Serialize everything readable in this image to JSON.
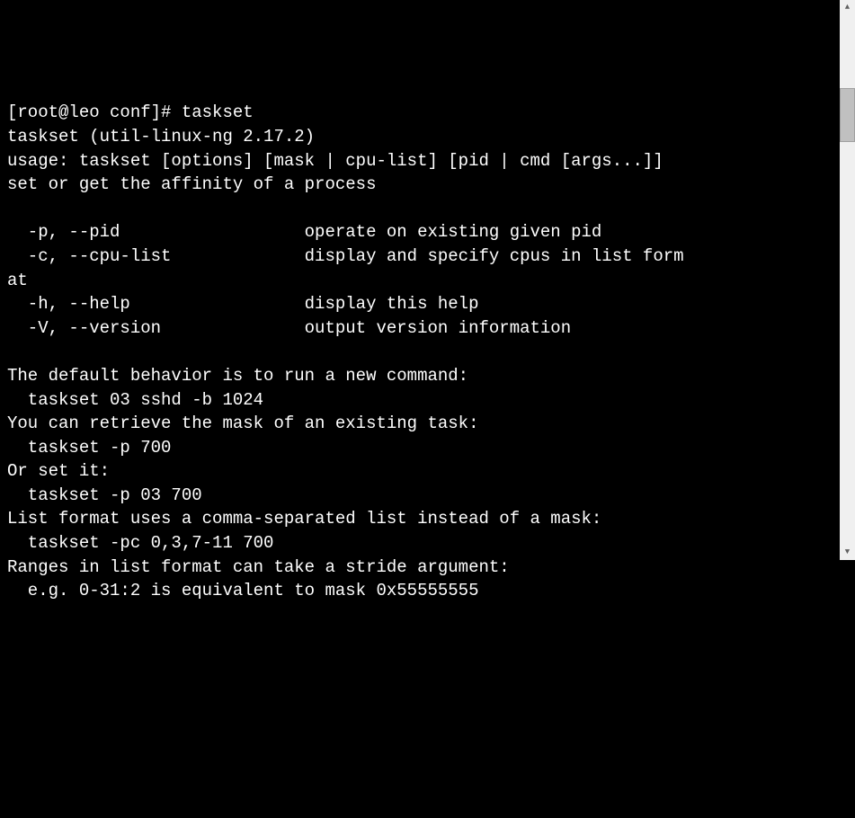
{
  "terminal": {
    "prompt": "[root@leo conf]# ",
    "command": "taskset",
    "line_version": "taskset (util-linux-ng 2.17.2)",
    "line_usage": "usage: taskset [options] [mask | cpu-list] [pid | cmd [args...]]",
    "line_desc": "set or get the affinity of a process",
    "opt_pid": "  -p, --pid                  operate on existing given pid",
    "opt_cpulist_a": "  -c, --cpu-list             display and specify cpus in list form",
    "opt_cpulist_b": "at",
    "opt_help": "  -h, --help                 display this help",
    "opt_version": "  -V, --version              output version information",
    "ex_default_hdr": "The default behavior is to run a new command:",
    "ex_default_cmd": "  taskset 03 sshd -b 1024",
    "ex_retrieve_hdr": "You can retrieve the mask of an existing task:",
    "ex_retrieve_cmd": "  taskset -p 700",
    "ex_set_hdr": "Or set it:",
    "ex_set_cmd": "  taskset -p 03 700",
    "ex_list_hdr": "List format uses a comma-separated list instead of a mask:",
    "ex_list_cmd": "  taskset -pc 0,3,7-11 700",
    "ex_range_hdr": "Ranges in list format can take a stride argument:",
    "ex_range_cmd": "  e.g. 0-31:2 is equivalent to mask 0x55555555"
  }
}
